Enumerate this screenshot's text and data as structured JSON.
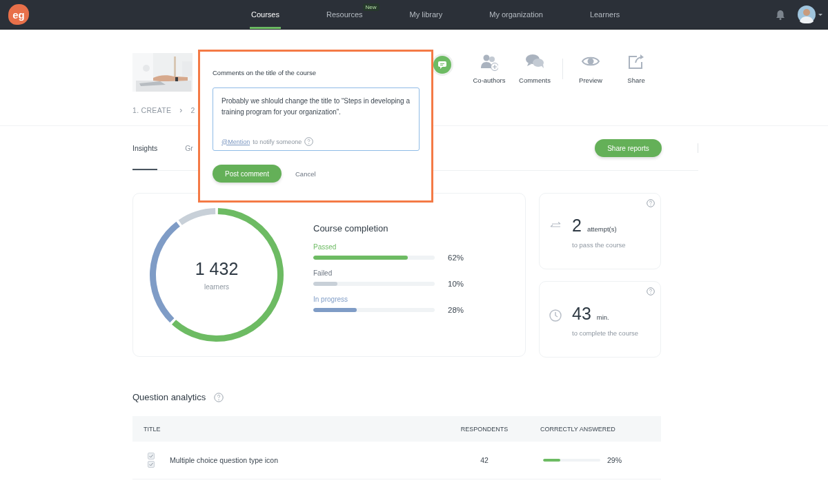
{
  "navbar": {
    "logo": "eg",
    "tabs": [
      {
        "label": "Courses",
        "selected": true
      },
      {
        "label": "Resources",
        "selected": false,
        "badge": "New"
      },
      {
        "label": "My library",
        "selected": false
      },
      {
        "label": "My organization",
        "selected": false
      },
      {
        "label": "Learners",
        "selected": false
      }
    ]
  },
  "course_header": {
    "thumbnail": {
      "kind": "picture"
    },
    "actions": [
      {
        "kind": "coauthors",
        "label": "Co-authors"
      },
      {
        "kind": "comments",
        "label": "Comments"
      },
      {
        "kind": "preview",
        "label": "Preview"
      },
      {
        "kind": "share",
        "label": "Share"
      }
    ],
    "steps": [
      "1. CREATE",
      "›",
      "2"
    ]
  },
  "comment_popup": {
    "title": "Comments on the title of the course",
    "value": "Probably we shlould change the title to “Steps in developing a training program for your organization”.",
    "mention_link": "@Mention",
    "mention_hint": "to notify someone",
    "post_button": "Post comment",
    "cancel_button": "Cancel"
  },
  "report_tabs": [
    {
      "label": "Insights",
      "selected": true
    },
    {
      "label": "Gr",
      "selected": false
    }
  ],
  "share_reports_button": "Share reports",
  "completion_card": {
    "total": "1 432",
    "total_label": "learners",
    "title": "Course completion",
    "items": [
      {
        "color": "#6dbb63",
        "level": 0.78,
        "reading": "62%"
      },
      {
        "color": "#c8d0d8",
        "level": 0.2,
        "reading": "10%"
      },
      {
        "color": "#7f9cc6",
        "level": 0.36,
        "reading": "28%"
      }
    ],
    "chart_data": {
      "type": "donut",
      "categories": [
        "Passed",
        "Failed",
        "In progress"
      ],
      "values": [
        62,
        10,
        28
      ]
    }
  },
  "stat_cards": [
    {
      "kind": "attempts",
      "value": "2",
      "unit": "attempt(s)",
      "caption": "to pass the course"
    },
    {
      "kind": "time",
      "value": "43",
      "unit": "min.",
      "caption": "to complete the course"
    }
  ],
  "question_analytics": {
    "title": "Question analytics",
    "columns": [
      "TITLE",
      "RESPONDENTS",
      "CORRECTLY ANSWERED"
    ],
    "rows": [
      {
        "title": "Multiple choice question type icon",
        "respondents": "42",
        "level": 0.3,
        "reading": "29%"
      }
    ]
  }
}
